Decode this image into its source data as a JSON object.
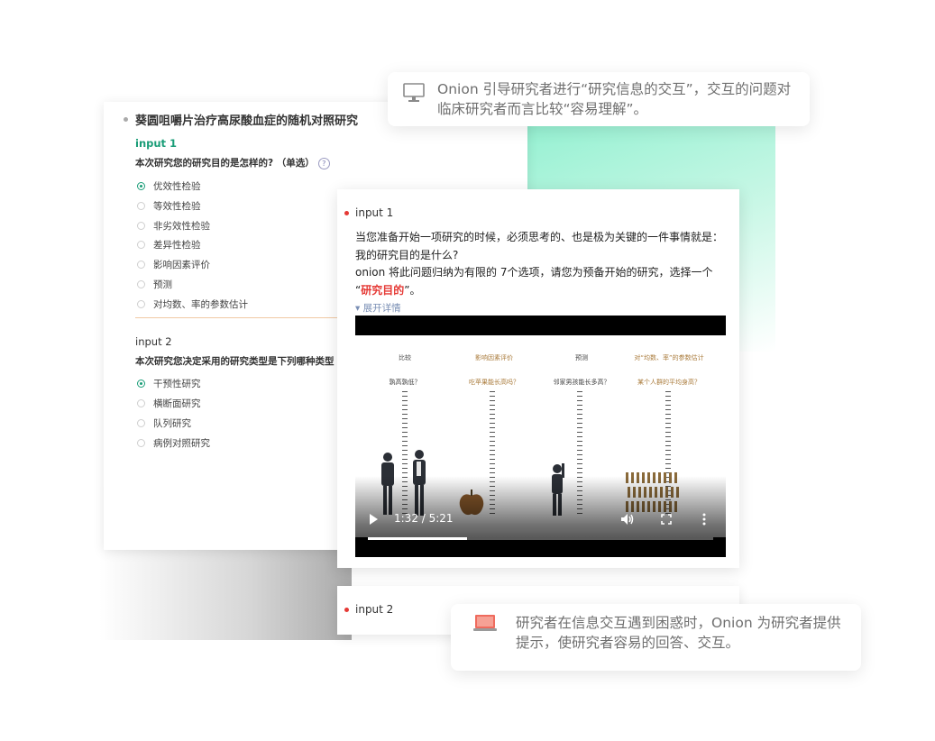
{
  "back_card": {
    "title": "葵圆咀嚼片治疗高尿酸血症的随机对照研究",
    "input1": {
      "label": "input 1",
      "question": "本次研究您的研究目的是怎样的? （单选）",
      "help_symbol": "?",
      "options": [
        "优效性检验",
        "等效性检验",
        "非劣效性检验",
        "差异性检验",
        "影响因素评价",
        "预测",
        "对均数、率的参数估计"
      ],
      "selected_index": 0
    },
    "input2": {
      "label": "input 2",
      "question": "本次研究您决定采用的研究类型是下列哪种类型",
      "options": [
        "干预性研究",
        "横断面研究",
        "队列研究",
        "病例对照研究"
      ],
      "selected_index": 0
    }
  },
  "front_card": {
    "input1_label": "input 1",
    "para_line1": "当您准备开始一项研究的时候，必须思考的、也是极为关键的一件事情就是：我的研究目的是什么?",
    "para_line2_pre": "onion 将此问题归纳为有限的 7个选项，请您为预备开始的研究，选择一个 “",
    "para_highlight": "研究目的",
    "para_line2_post": "”。",
    "expand_label": "展开详情",
    "video": {
      "columns": [
        {
          "title": "比较",
          "question": "孰高孰低？",
          "tone": "dark"
        },
        {
          "title": "影响因素评价",
          "question": "吃苹果能长高吗？",
          "tone": "brown"
        },
        {
          "title": "预测",
          "question": "邻家男孩能长多高？",
          "tone": "dark"
        },
        {
          "title": "对“均数、率”的参数估计",
          "question": "某个人群的平均身高？",
          "tone": "brown"
        }
      ],
      "time": "1:32 / 5:21",
      "progress_fraction": 0.2866
    },
    "input2_label": "input 2"
  },
  "callouts": {
    "top": "Onion 引导研究者进行“研究信息的交互”，交互的问题对临床研究者而言比较“容易理解”。",
    "bottom": "研究者在信息交互遇到困惑时，Onion 为研究者提供提示，使研究者容易的回答、交互。"
  },
  "icons": {
    "top_callout": "monitor-icon",
    "bottom_callout": "laptop-icon"
  },
  "colors": {
    "accent_green": "#1a9d78",
    "highlight_red": "#e53935",
    "glow_mint": "#8ef0cf"
  }
}
